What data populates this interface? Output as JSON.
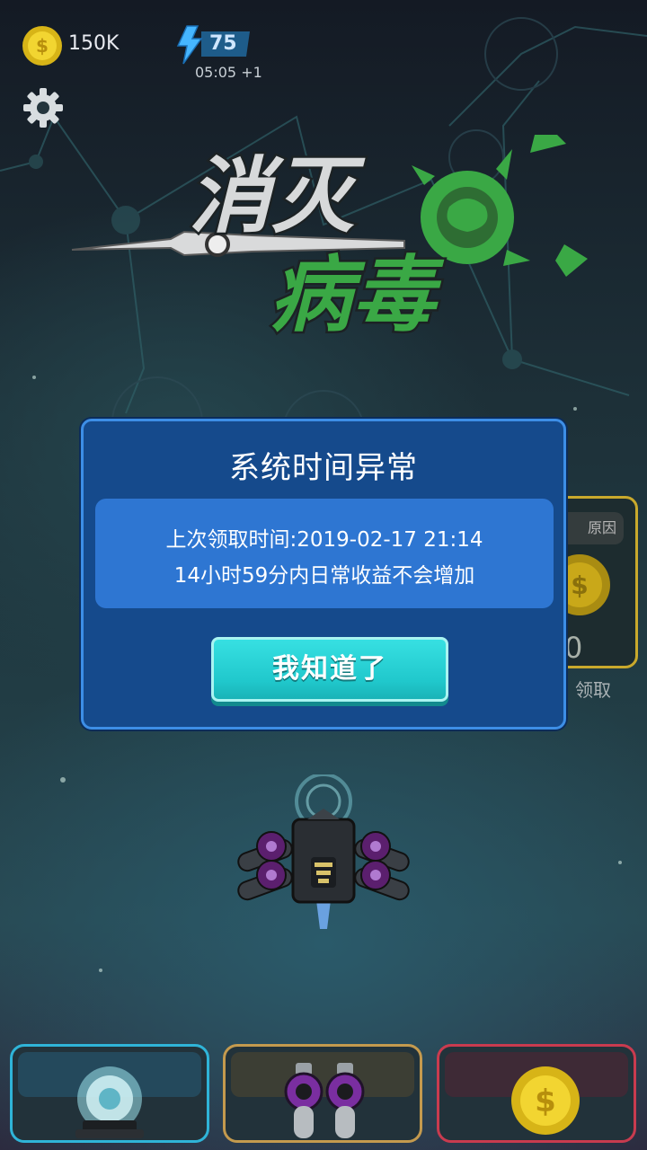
{
  "hud": {
    "coins": "150K",
    "energy": "75",
    "energy_timer": "05:05 +1",
    "icons": [
      "coin-icon",
      "lightning-icon",
      "gear-icon"
    ]
  },
  "logo": {
    "line1": "消灭",
    "line2": "病毒"
  },
  "reward_card": {
    "tag": "原因",
    "value": "0",
    "claim_label": "领取"
  },
  "dialog": {
    "title": "系统时间异常",
    "message_line1": "上次领取时间:2019-02-17 21:14",
    "message_line2": "14小时59分内日常收益不会增加",
    "confirm_button": "我知道了"
  },
  "bottom_bar": {
    "items": [
      {
        "name": "shield-upgrade",
        "icon": "shield-dome-icon"
      },
      {
        "name": "weapon-upgrade",
        "icon": "cannon-icon"
      },
      {
        "name": "coin-upgrade",
        "icon": "coin-icon"
      }
    ]
  },
  "colors": {
    "dialog_bg": "#154a8c",
    "dialog_border": "#3d8ee6",
    "message_bg": "#2e76d2",
    "button_bg": "#20c8cc",
    "logo_green": "#3aa845",
    "card_blue": "#2fb4d8",
    "card_gold": "#c49a4e",
    "card_red": "#c93b4f"
  }
}
